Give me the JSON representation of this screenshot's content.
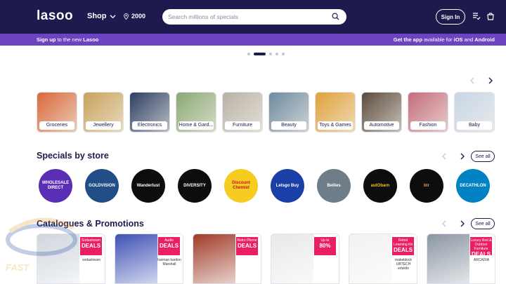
{
  "header": {
    "logo": "lasoo",
    "shop_label": "Shop",
    "location": "2000",
    "search_placeholder": "Search millions of specials",
    "signin_label": "Sign In"
  },
  "promo_bar": {
    "left_prefix": "Sign up",
    "left_middle": " to the new ",
    "left_brand": "Lasoo",
    "right_prefix": "Get the app",
    "right_middle": " available for ",
    "right_ios": "iOS",
    "right_and": " and ",
    "right_android": "Android"
  },
  "carousel": {
    "total": 5,
    "active": 2
  },
  "categories": [
    {
      "label": "Groceries",
      "color": "#d9683a"
    },
    {
      "label": "Jewellery",
      "color": "#c9a25a"
    },
    {
      "label": "Electronics",
      "color": "#2c3e63"
    },
    {
      "label": "Home & Gard...",
      "color": "#8aa873"
    },
    {
      "label": "Furniture",
      "color": "#b9b1a6"
    },
    {
      "label": "Beauty",
      "color": "#6e8aa0"
    },
    {
      "label": "Toys & Games",
      "color": "#e0a13a"
    },
    {
      "label": "Automotive",
      "color": "#5b4a3d"
    },
    {
      "label": "Fashion",
      "color": "#c46d7c"
    },
    {
      "label": "Baby",
      "color": "#c7d6e6"
    }
  ],
  "specials": {
    "title": "Specials by store",
    "see_all": "See all",
    "stores": [
      {
        "name": "WHOLESALE DIRECT",
        "bg": "#5a2fb5",
        "fg": "#ffffff"
      },
      {
        "name": "GOLDVISION",
        "bg": "#214e86",
        "fg": "#ffffff"
      },
      {
        "name": "Wanderlust",
        "bg": "#0d0d0d",
        "fg": "#ffffff"
      },
      {
        "name": "DIVERSITY",
        "bg": "#0d0d0d",
        "fg": "#ffffff"
      },
      {
        "name": "Discount Chemist",
        "bg": "#f5cc1f",
        "fg": "#c4122f"
      },
      {
        "name": "Letsgo Buy",
        "bg": "#1a3fa6",
        "fg": "#ffffff"
      },
      {
        "name": "Bellies",
        "bg": "#6f7d88",
        "fg": "#ffffff"
      },
      {
        "name": "autObarn",
        "bg": "#0d0d0d",
        "fg": "#f6c518"
      },
      {
        "name": "btr",
        "bg": "#0d0d0d",
        "fg": "#d2a45a"
      },
      {
        "name": "DECATHLON",
        "bg": "#0082c3",
        "fg": "#ffffff"
      }
    ]
  },
  "catalogues": {
    "title": "Catalogues & Promotions",
    "see_all": "See all",
    "items": [
      {
        "badge_small": "Sodastream",
        "badge_big": "DEALS",
        "brand": "sodastream",
        "pic": "#cfd6dc"
      },
      {
        "badge_small": "Audio",
        "badge_big": "DEALS",
        "brand": "harman kardon Marshall",
        "pic": "#3f51b5"
      },
      {
        "badge_small": "Retro Phone",
        "badge_big": "DEALS",
        "brand": "",
        "pic": "#a03c28"
      },
      {
        "badge_small": "Up to",
        "badge_big": "80%",
        "brand": "",
        "pic": "#e8e8e8"
      },
      {
        "badge_small": "Robot Learning Kit",
        "badge_big": "DEALS",
        "brand": "makeblock UBTECH edukits",
        "pic": "#f1f1f1"
      },
      {
        "badge_small": "Luxury Bed & Outdoor Furniture",
        "badge_big": "DEALS",
        "brand": "ARCADIA",
        "pic": "#8b96a3"
      }
    ]
  },
  "watermark": {
    "text": "FAST"
  }
}
